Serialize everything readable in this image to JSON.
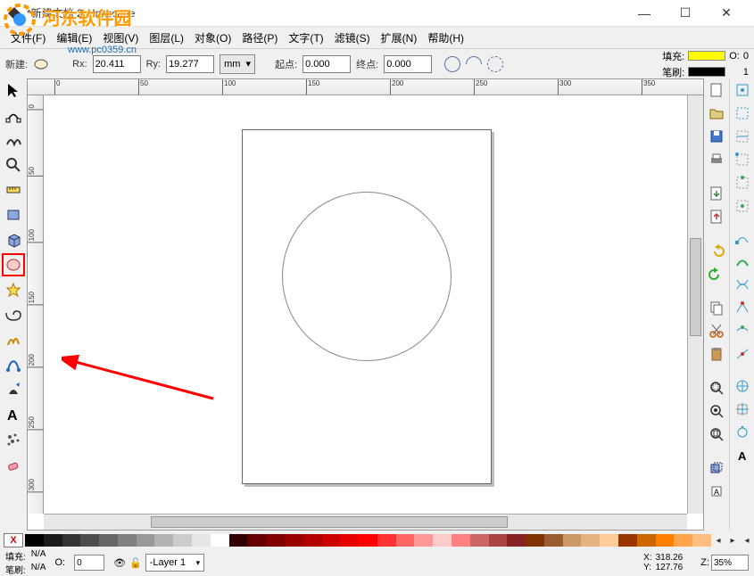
{
  "title": "*新建文档 2 - Inkscape",
  "watermark": {
    "text": "河东软件园",
    "url": "www.pc0359.cn"
  },
  "menu": {
    "file": "文件(F)",
    "edit": "编辑(E)",
    "view": "视图(V)",
    "layer": "图层(L)",
    "object": "对象(O)",
    "path": "路径(P)",
    "text": "文字(T)",
    "filter": "滤镜(S)",
    "extension": "扩展(N)",
    "help": "帮助(H)"
  },
  "tool_options": {
    "new_label": "新建:",
    "rx_label": "Rx:",
    "rx": "20.411",
    "ry_label": "Ry:",
    "ry": "19.277",
    "unit": "mm",
    "start_label": "起点:",
    "start": "0.000",
    "end_label": "终点:",
    "end": "0.000"
  },
  "fillstroke": {
    "fill_label": "填充:",
    "stroke_label": "笔刷:",
    "o_label": "O:",
    "o_value": "0",
    "stroke_width": "1"
  },
  "ruler_h": [
    "0",
    "50",
    "100",
    "150",
    "200",
    "250",
    "300",
    "350"
  ],
  "ruler_v": [
    "0",
    "50",
    "100",
    "150",
    "200",
    "250",
    "300"
  ],
  "palette_x": "X",
  "palette": [
    "#000000",
    "#1a1a1a",
    "#333333",
    "#4d4d4d",
    "#666666",
    "#808080",
    "#999999",
    "#b3b3b3",
    "#cccccc",
    "#e6e6e6",
    "#ffffff",
    "#330000",
    "#660000",
    "#800000",
    "#990000",
    "#b30000",
    "#cc0000",
    "#e60000",
    "#ff0000",
    "#ff3333",
    "#ff6666",
    "#ff9999",
    "#ffcccc",
    "#ff8080",
    "#cc6666",
    "#aa4444",
    "#882222",
    "#803300",
    "#995c33",
    "#cc9966",
    "#e6b380",
    "#ffcc99",
    "#993300",
    "#cc6600",
    "#ff8000",
    "#ffa64d",
    "#ffbf80"
  ],
  "status": {
    "fill_label": "填充:",
    "fill": "N/A",
    "stroke_label": "笔刷:",
    "stroke": "N/A",
    "o_label": "O:",
    "o": "0",
    "layer_label": "-Layer 1",
    "x_label": "X:",
    "x": "318.26",
    "y_label": "Y:",
    "y": "127.76",
    "z_label": "Z:",
    "zoom": "35%"
  }
}
